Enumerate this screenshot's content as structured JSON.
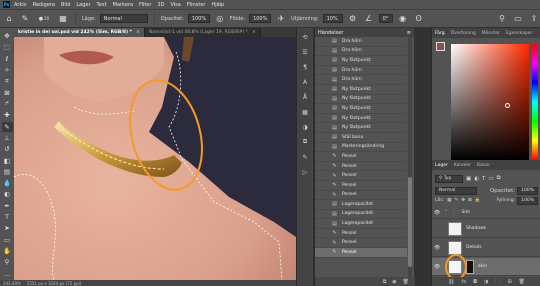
{
  "app": {
    "logo": "Ps"
  },
  "menu": [
    "Arkiv",
    "Redigera",
    "Bild",
    "Lager",
    "Text",
    "Markera",
    "Filter",
    "3D",
    "Visa",
    "Fönster",
    "Hjälp"
  ],
  "options": {
    "mode_label": "Läge:",
    "mode_value": "Normal",
    "opacity_label": "Opacitet:",
    "opacity_value": "100%",
    "flow_label": "Flöde:",
    "flow_value": "100%",
    "smoothing_label": "Utjämning:",
    "smoothing_value": "10%",
    "angle_value": "0°",
    "brush_size": "20"
  },
  "tabs": [
    {
      "label": "kristie in dei sol.psd vid 242% (Sim, RGB/8) *",
      "active": true
    },
    {
      "label": "Namnlöst-1 vid 48,8% (Lager 19, RGB/8#) *",
      "active": false
    }
  ],
  "toolbar": {
    "tools": [
      "move",
      "marquee",
      "lasso",
      "quick-select",
      "crop",
      "frame",
      "eyedropper",
      "healing",
      "brush",
      "stamp",
      "history-brush",
      "eraser",
      "gradient",
      "blur",
      "dodge",
      "pen",
      "type",
      "path-select",
      "shape",
      "hand",
      "zoom",
      "more"
    ],
    "active": "brush"
  },
  "status": {
    "zoom": "242,49%",
    "doc": "2551 px x 3244 px (72 ppi)"
  },
  "iconstrip": [
    "history-icon",
    "properties-icon",
    "paragraph-icon",
    "character-icon",
    "glyphs-icon",
    "swatches-icon",
    "adjustments-icon",
    "libraries-icon",
    "brush-settings-icon",
    "actions-icon"
  ],
  "history": {
    "title": "Händelser",
    "items": [
      {
        "icon": "page",
        "label": "Dra hörn"
      },
      {
        "icon": "page",
        "label": "Dra hörn"
      },
      {
        "icon": "page",
        "label": "Ny fästpunkt"
      },
      {
        "icon": "page",
        "label": "Dra hörn"
      },
      {
        "icon": "page",
        "label": "Dra hörn"
      },
      {
        "icon": "page",
        "label": "Ny fästpunkt"
      },
      {
        "icon": "page",
        "label": "Ny fästpunkt"
      },
      {
        "icon": "page",
        "label": "Ny fästpunkt"
      },
      {
        "icon": "page",
        "label": "Ny fästpunkt"
      },
      {
        "icon": "page",
        "label": "Ny fästpunkt"
      },
      {
        "icon": "page",
        "label": "Stäl bana"
      },
      {
        "icon": "page",
        "label": "Markeringsändring"
      },
      {
        "icon": "brush",
        "label": "Pensel"
      },
      {
        "icon": "brush",
        "label": "Pensel"
      },
      {
        "icon": "brush",
        "label": "Pensel"
      },
      {
        "icon": "brush",
        "label": "Pensel"
      },
      {
        "icon": "brush",
        "label": "Pensel"
      },
      {
        "icon": "page",
        "label": "Lageropacitet"
      },
      {
        "icon": "page",
        "label": "Lageropacitet"
      },
      {
        "icon": "page",
        "label": "Lageropacitet"
      },
      {
        "icon": "brush",
        "label": "Pensel"
      },
      {
        "icon": "brush",
        "label": "Pensel"
      },
      {
        "icon": "brush",
        "label": "Pensel",
        "selected": true
      }
    ]
  },
  "color": {
    "tabs": [
      "Färg",
      "Övertoning",
      "Mönster",
      "Egenskaper"
    ],
    "foreground": "#8a4f4a",
    "background": "#111111"
  },
  "layers": {
    "tabs": [
      "Lager",
      "Kanaler",
      "Banor"
    ],
    "filter_value": "Typ",
    "blend_value": "Normal",
    "opacity_label": "Opacitet:",
    "opacity_value": "100%",
    "lock_label": "Lås:",
    "fill_label": "Fyllning:",
    "fill_value": "100%",
    "rows": [
      {
        "type": "group",
        "name": "Sim",
        "visible": true
      },
      {
        "type": "layer",
        "name": "Shadows",
        "visible": false
      },
      {
        "type": "layer",
        "name": "Details",
        "visible": true
      },
      {
        "type": "layer",
        "name": "skin",
        "visible": true,
        "selected": true
      }
    ]
  },
  "accent": "#f39a2a"
}
